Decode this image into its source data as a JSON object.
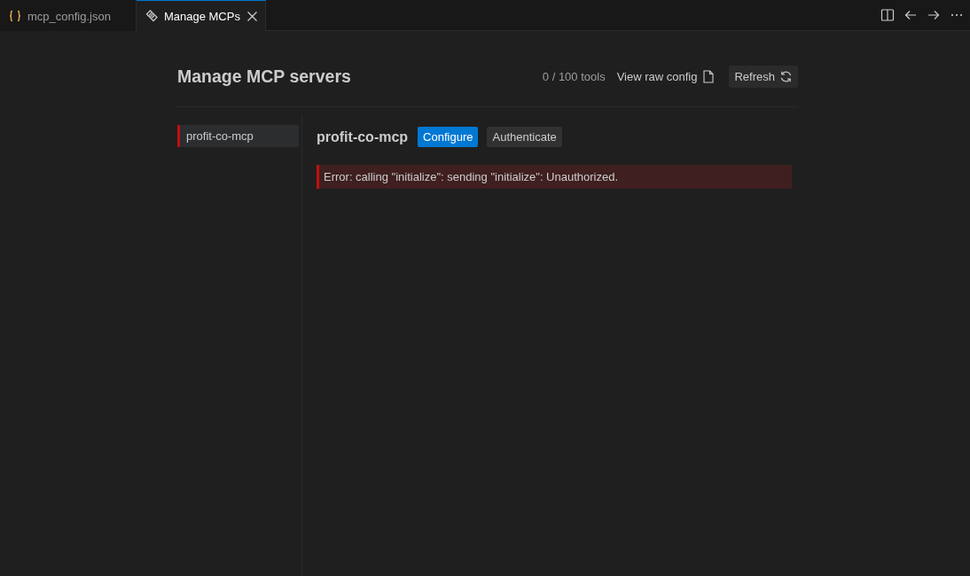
{
  "tabs": [
    {
      "label": "mcp_config.json",
      "kind": "json",
      "selected": false
    },
    {
      "label": "Manage MCPs",
      "kind": "mcp",
      "selected": true
    }
  ],
  "page": {
    "title": "Manage MCP servers",
    "tool_count": "0 / 100 tools",
    "view_config_link": "View raw config",
    "refresh_button": "Refresh"
  },
  "servers": [
    {
      "name": "profit-co-mcp",
      "color": "#c10f0f",
      "selected": true
    }
  ],
  "detail": {
    "name": "profit-co-mcp",
    "buttons": [
      {
        "label": "Configure",
        "kind": "primary"
      },
      {
        "label": "Authenticate",
        "kind": "secondary"
      }
    ],
    "error": "Error: calling \"initialize\": sending \"initialize\": Unauthorized."
  }
}
